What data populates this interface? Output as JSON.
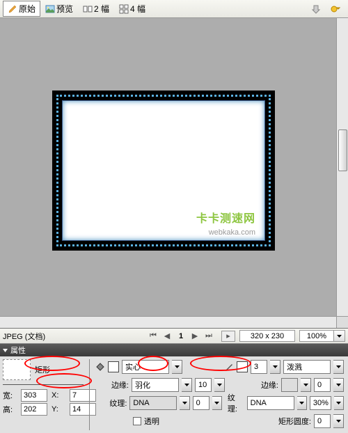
{
  "toolbar": {
    "original": "原始",
    "preview": "预览",
    "two_up": "2 幅",
    "four_up": "4 幅"
  },
  "status": {
    "format": "JPEG (文档)",
    "page": "1",
    "dims": "320 x 230",
    "zoom": "100%"
  },
  "properties": {
    "panel_title": "属性",
    "shape_label": "矩形",
    "width_label": "宽:",
    "width_val": "303",
    "height_label": "高:",
    "height_val": "202",
    "x_label": "X:",
    "x_val": "7",
    "y_label": "Y:",
    "y_val": "14",
    "fill_type": "实心",
    "edge_label": "边缘:",
    "edge_type": "羽化",
    "edge_val": "10",
    "texture_label": "纹理:",
    "texture_type_l": "DNA",
    "texture_val_l": "0",
    "transparent": "透明",
    "stroke_width": "3",
    "stroke_type": "泼溅",
    "stroke_edge_label": "边缘:",
    "stroke_edge_val": "0",
    "texture_type_r": "DNA",
    "texture_val_r": "30%",
    "roundness_label": "矩形圆度:",
    "roundness_val": "0"
  },
  "watermark": {
    "main": "卡卡测速网",
    "sub": "webkaka.com"
  }
}
